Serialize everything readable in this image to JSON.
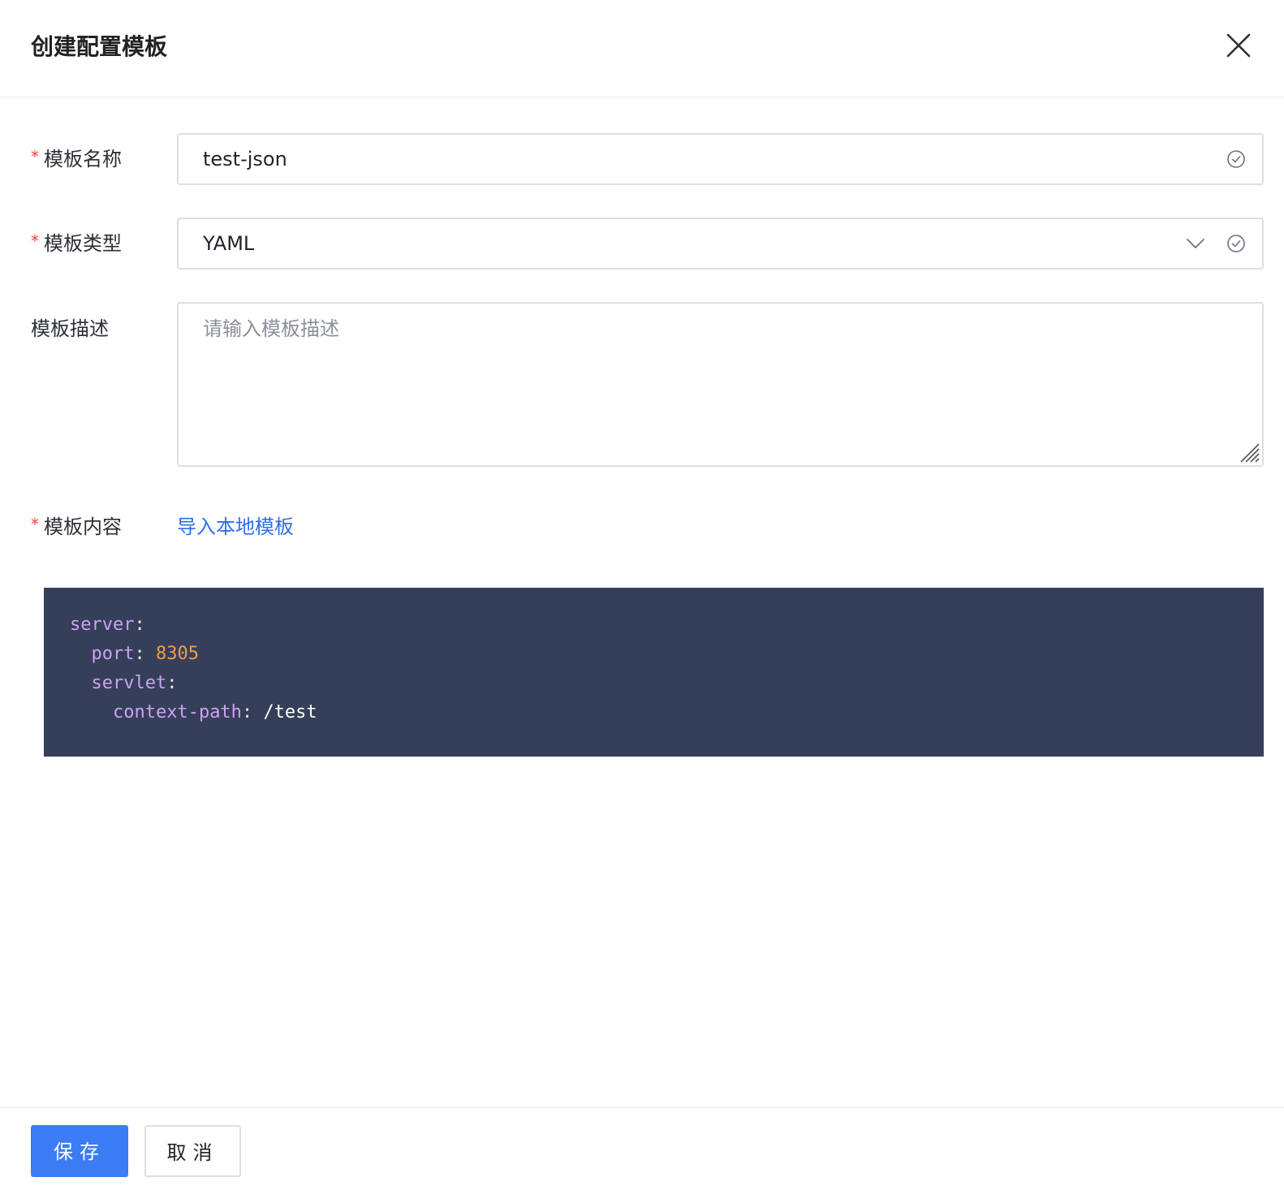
{
  "dialog": {
    "title": "创建配置模板"
  },
  "form": {
    "name": {
      "required_mark": "*",
      "label": "模板名称",
      "value": "test-json"
    },
    "type": {
      "required_mark": "*",
      "label": "模板类型",
      "value": "YAML"
    },
    "description": {
      "label": "模板描述",
      "placeholder": "请输入模板描述"
    },
    "content": {
      "required_mark": "*",
      "label": "模板内容",
      "import_link": "导入本地模板"
    }
  },
  "code": {
    "lines": [
      {
        "indent": "",
        "key": "server",
        "sep": ":",
        "value": "",
        "value_type": ""
      },
      {
        "indent": "  ",
        "key": "port",
        "sep": ": ",
        "value": "8305",
        "value_type": "num"
      },
      {
        "indent": "  ",
        "key": "servlet",
        "sep": ":",
        "value": "",
        "value_type": ""
      },
      {
        "indent": "    ",
        "key": "context-path",
        "sep": ": ",
        "value": "/test",
        "value_type": "str"
      }
    ]
  },
  "footer": {
    "save_label": "保存",
    "cancel_label": "取消"
  },
  "colors": {
    "primary": "#3b7cf5",
    "link": "#2f6fe4",
    "required": "#f53f3f",
    "code_bg": "#363f59",
    "code_key": "#c9a3f0",
    "code_number": "#f29a4a"
  },
  "icons": {
    "close": "close-icon",
    "check": "check-circle-icon",
    "chevron": "chevron-down-icon",
    "resize": "resize-handle-icon"
  }
}
